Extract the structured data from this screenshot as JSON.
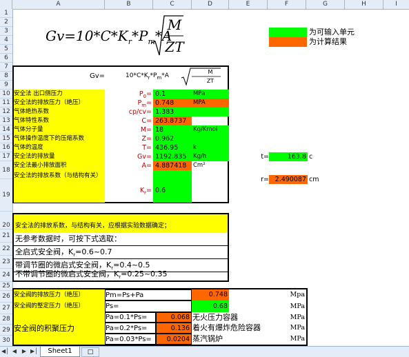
{
  "columns": [
    "A",
    "B",
    "C",
    "D",
    "E",
    "F",
    "G",
    "H",
    "I"
  ],
  "rows": [
    "1",
    "2",
    "3",
    "4",
    "5",
    "6",
    "7",
    "8",
    "9",
    "10",
    "11",
    "12",
    "13",
    "14",
    "15",
    "16",
    "17",
    "18",
    "19",
    "20",
    "21",
    "22",
    "23",
    "24",
    "25",
    "26",
    "27",
    "28",
    "29",
    "30"
  ],
  "big_formula": {
    "lhs": "Gv=10*C*K",
    "sub": "r",
    "mid": "*P",
    "sub2": "m",
    "tail": "*A",
    "num": "M",
    "den": "ZT"
  },
  "legend": {
    "green_label": "为可输入单元",
    "orange_label": "为计算结果",
    "green": "#00ff00",
    "orange": "#ff6600"
  },
  "formula_row": {
    "label": "Gv=",
    "expr": "10*C*K",
    "sub": "r",
    "expr2": "*P",
    "sub2": "m",
    "expr3": "*A",
    "num": "M",
    "den": "ZT"
  },
  "params": [
    {
      "desc": "安全法 出口侧压力",
      "sym": "P",
      "sub": "0",
      "eq": "=",
      "value": "0.1",
      "unit": "MPa",
      "value_color": "green"
    },
    {
      "desc": "安全法的排放压力（绝压）",
      "sym": "P",
      "sub": "m",
      "eq": "=",
      "value": "0.748",
      "unit": "MPA",
      "value_color": "orange"
    },
    {
      "desc": "气体绝热系数",
      "sym": "cp/cv",
      "sub": "",
      "eq": "=",
      "value": "1.383",
      "unit": "",
      "value_color": "green"
    },
    {
      "desc": "气体特性系数",
      "sym": "C",
      "sub": "",
      "eq": "=",
      "value": "263.8737",
      "unit": "",
      "value_color": "orange"
    },
    {
      "desc": "气体分子量",
      "sym": "M",
      "sub": "",
      "eq": "=",
      "value": "18",
      "unit": "Kg/Kmol",
      "value_color": "green"
    },
    {
      "desc": "气体操作温度下的压缩系数",
      "sym": "Z",
      "sub": "",
      "eq": "=",
      "value": "0.962",
      "unit": "",
      "value_color": "green"
    },
    {
      "desc": "气体的温度",
      "sym": "T",
      "sub": "",
      "eq": "=",
      "value": "436.95",
      "unit": "k",
      "value_color": "green"
    },
    {
      "desc": "安全法的排放量",
      "sym": "Gv",
      "sub": "",
      "eq": "=",
      "value": "1192.835",
      "unit": "Kg/h",
      "value_color": "green"
    },
    {
      "desc": "安全法最小排放面积",
      "sym": "A",
      "sub": "",
      "eq": "=",
      "value": "4.887418",
      "unit": "Cm²",
      "value_color": "orange"
    },
    {
      "desc": "安全法的排放系数（与结构有关）",
      "sym": "K",
      "sub": "r",
      "eq": "=",
      "value": "0.6",
      "unit": "",
      "value_color": "green"
    }
  ],
  "side": {
    "t_label": "t=",
    "t_value": "163.8",
    "t_unit": "c",
    "r_label": "r=",
    "r_value": "2.490087",
    "r_unit": "cm"
  },
  "note": {
    "header": "安全法的排放系数，与结构有关，应根据实验数据确定；",
    "line1": "无参考数据时，可按下式选取：",
    "line2": "全启式安全阀，K",
    "line2_sub": "r",
    "line2_tail": "=0.6~0.7",
    "line3": "带调节圈的微启式安全阀，K",
    "line3_sub": "r",
    "line3_tail": "=0.4~0.5",
    "line4": "不带调节圈的微启式安全阀，K",
    "line4_sub": "r",
    "line4_tail": "=0.25~0.35"
  },
  "bottom": {
    "r26_label": "安全阀的排放压力（绝压）",
    "r26_expr": "Pm=Ps+Pa",
    "r26_value": "0.748",
    "r26_unit": "Mpa",
    "r27_label": "安全阀的整定压力（绝压）",
    "r27_expr": "Ps=",
    "r27_value": "0.68",
    "r27_unit": "MPa",
    "accum_label": "安全阀的积聚压力",
    "r28_expr": "Pa=0.1*Ps=",
    "r28_value": "0.068",
    "r28_desc": "无火压力容器",
    "r28_unit": "MPa",
    "r29_expr": "Pa=0.2*Ps=",
    "r29_value": "0.136",
    "r29_desc": "着火有爆炸危险容器",
    "r29_unit": "MPa",
    "r30_expr": "Pa=0.03*Ps=",
    "r30_value": "0.0204",
    "r30_desc": "蒸汽锅炉",
    "r30_unit": "MPa"
  },
  "tabs": {
    "sheet": "Sheet1"
  }
}
